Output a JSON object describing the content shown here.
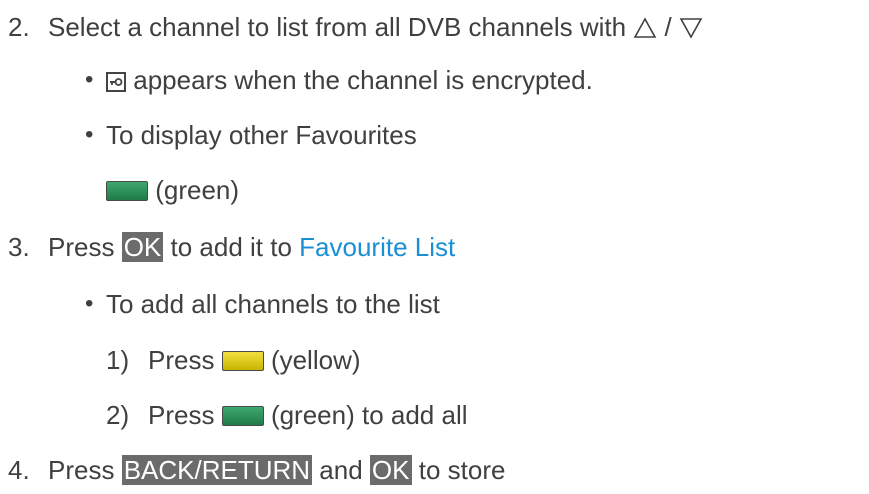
{
  "steps": [
    {
      "num": "2.",
      "text": "Select a channel to list from all DVB channels with",
      "sep": "/"
    },
    {
      "num": "3.",
      "pre": "Press",
      "key": "OK",
      "mid": "to add it to",
      "link": "Favourite List"
    },
    {
      "num": "4.",
      "pre": "Press",
      "key1": "BACK/RETURN",
      "mid": "and",
      "key2": "OK",
      "post": "to store"
    }
  ],
  "bullets": {
    "encrypted": "appears when the channel is encrypted.",
    "other_favourites": "To display other Favourites",
    "green_label": "(green)",
    "add_all": "To add all channels to the list"
  },
  "substeps": [
    {
      "num": "1)",
      "pre": "Press",
      "label": "(yellow)"
    },
    {
      "num": "2)",
      "pre": "Press",
      "label": "(green) to add all"
    }
  ],
  "icons": {
    "up": "up-triangle-icon",
    "down": "down-triangle-icon",
    "lock": "lock-icon",
    "green": "green-button-icon",
    "yellow": "yellow-button-icon"
  },
  "colors": {
    "text": "#404040",
    "link": "#1a8fd6",
    "key_bg": "#6b6b6b",
    "green": "#2e8f5a",
    "yellow": "#e0cc20"
  }
}
